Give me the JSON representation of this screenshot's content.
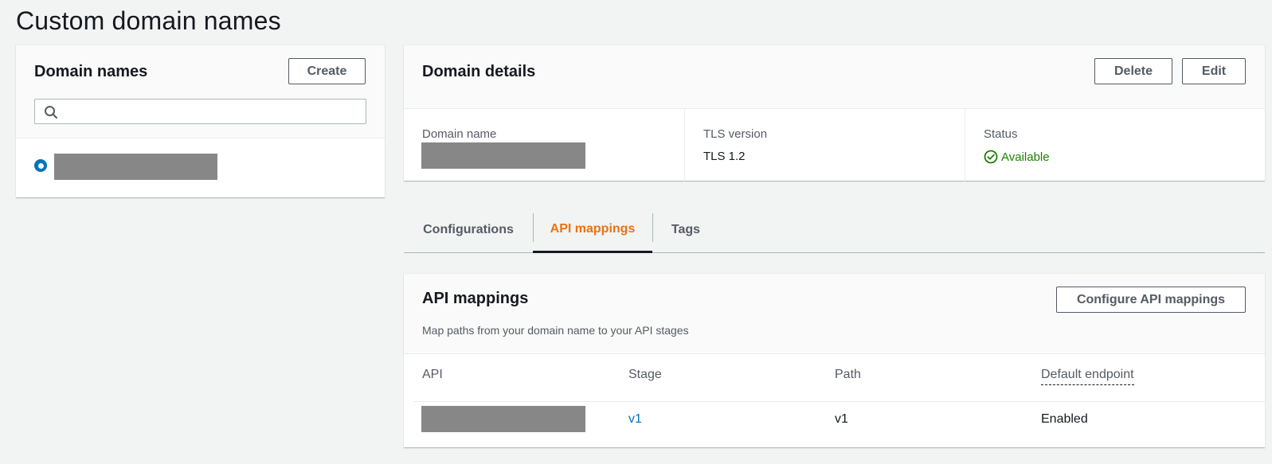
{
  "page": {
    "title": "Custom domain names"
  },
  "domain_list": {
    "title": "Domain names",
    "create_label": "Create",
    "search": {
      "value": "",
      "placeholder": "",
      "icon": "search-icon"
    },
    "items": [
      {
        "name": "",
        "selected": true,
        "redacted": true
      }
    ]
  },
  "domain_details": {
    "title": "Domain details",
    "delete_label": "Delete",
    "edit_label": "Edit",
    "fields": {
      "domain_name": {
        "label": "Domain name",
        "value": "",
        "redacted": true
      },
      "tls": {
        "label": "TLS version",
        "value": "TLS 1.2"
      },
      "status": {
        "label": "Status",
        "value": "Available",
        "icon": "check-circle-icon",
        "color": "#1d8102"
      }
    }
  },
  "tabs": [
    {
      "label": "Configurations",
      "active": false
    },
    {
      "label": "API mappings",
      "active": true
    },
    {
      "label": "Tags",
      "active": false
    }
  ],
  "api_mappings": {
    "title": "API mappings",
    "description": "Map paths from your domain name to your API stages",
    "configure_label": "Configure API mappings",
    "columns": [
      "API",
      "Stage",
      "Path",
      "Default endpoint"
    ],
    "rows": [
      {
        "api": "",
        "api_redacted": true,
        "stage": "v1",
        "path": "v1",
        "default_endpoint": "Enabled"
      }
    ]
  },
  "colors": {
    "accent": "#ec7211",
    "link": "#0073bb",
    "success": "#1d8102",
    "background": "#f2f3f3"
  }
}
